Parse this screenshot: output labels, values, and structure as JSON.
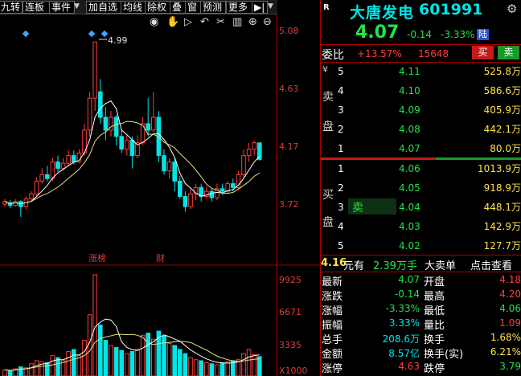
{
  "toolbar": {
    "items": [
      "九转",
      "连板",
      "事件",
      "加自选",
      "均线",
      "除权",
      "叠",
      "窗",
      "预测",
      "更多"
    ]
  },
  "chart": {
    "price_axis": [
      "5.08",
      "4.63",
      "4.17",
      "3.72"
    ],
    "volume_axis": [
      "9925",
      "6671",
      "3335",
      "X1000"
    ],
    "high_marker": "4.99",
    "events": [
      "涨榜",
      "财"
    ]
  },
  "stock": {
    "market_tag": "R",
    "name": "大唐发电",
    "code": "601991",
    "price": "4.07",
    "change": "-0.14",
    "change_pct": "-3.33%",
    "exchange_tag": "陆"
  },
  "weibi": {
    "label": "委比",
    "ratio": "+13.57%",
    "diff": "15648",
    "buy_btn": "买",
    "sell_btn": "卖"
  },
  "asks": [
    {
      "level": "5",
      "price": "4.11",
      "vol": "525.8万"
    },
    {
      "level": "4",
      "price": "4.10",
      "vol": "586.6万"
    },
    {
      "level": "3",
      "price": "4.09",
      "vol": "405.9万"
    },
    {
      "level": "2",
      "price": "4.08",
      "vol": "442.1万"
    },
    {
      "level": "1",
      "price": "4.07",
      "vol": "80.0万"
    }
  ],
  "ask_label": [
    "¥",
    "卖",
    "盘"
  ],
  "bids": [
    {
      "level": "1",
      "price": "4.06",
      "vol": "1013.9万"
    },
    {
      "level": "2",
      "price": "4.05",
      "vol": "918.9万"
    },
    {
      "level": "3",
      "price": "4.04",
      "vol": "448.1万"
    },
    {
      "level": "4",
      "price": "4.03",
      "vol": "142.9万"
    },
    {
      "level": "5",
      "price": "4.02",
      "vol": "127.7万"
    }
  ],
  "bid_label": [
    "买",
    "盘"
  ],
  "bid_highlight": "卖",
  "big_order": {
    "price": "4.16",
    "unit": "元有",
    "vol": "2.39万手",
    "label": "大卖单",
    "link": "点击查看"
  },
  "stats_left": [
    {
      "label": "最新",
      "value": "4.07"
    },
    {
      "label": "涨跌",
      "value": "-0.14"
    },
    {
      "label": "涨幅",
      "value": "-3.33%"
    },
    {
      "label": "振幅",
      "value": "3.33%"
    },
    {
      "label": "总手",
      "value": "208.6万"
    },
    {
      "label": "金额",
      "value": "8.57亿"
    },
    {
      "label": "涨停",
      "value": "4.63"
    }
  ],
  "stats_right": [
    {
      "label": "开盘",
      "value": "4.18"
    },
    {
      "label": "最高",
      "value": "4.20"
    },
    {
      "label": "最低",
      "value": "4.06"
    },
    {
      "label": "量比",
      "value": "1.09"
    },
    {
      "label": "换手",
      "value": "1.68%"
    },
    {
      "label": "换手(实)",
      "value": "6.21%"
    },
    {
      "label": "跌停",
      "value": "3.79"
    }
  ]
}
